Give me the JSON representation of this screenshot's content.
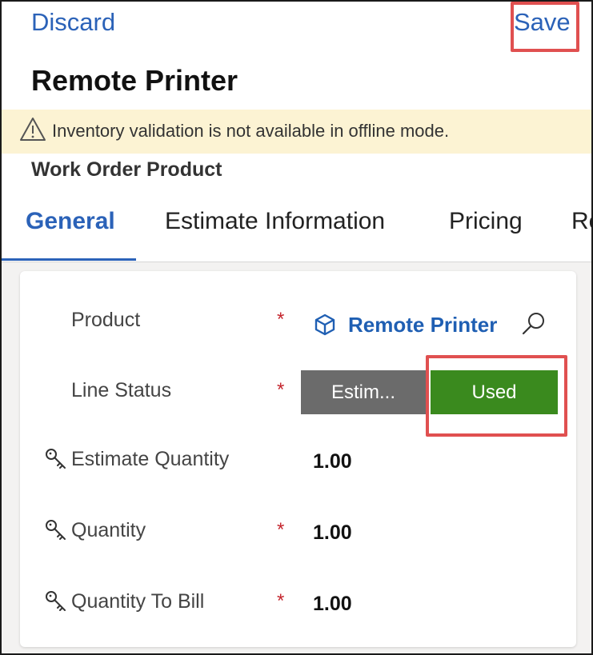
{
  "header": {
    "discard_label": "Discard",
    "save_label": "Save",
    "record_title": "Remote Printer"
  },
  "banner": {
    "icon": "warning-triangle-icon",
    "message": "Inventory validation is not available in offline mode."
  },
  "form": {
    "entity_name": "Work Order Product",
    "tabs": [
      {
        "label": "General",
        "active": true
      },
      {
        "label": "Estimate Information",
        "active": false
      },
      {
        "label": "Pricing",
        "active": false
      },
      {
        "label": "Re",
        "active": false
      }
    ]
  },
  "fields": {
    "product": {
      "label": "Product",
      "required": "*",
      "value": "Remote Printer",
      "icon": "cube-icon",
      "lookup_icon": "search-icon"
    },
    "line_status": {
      "label": "Line Status",
      "required": "*",
      "options": [
        "Estim...",
        "Used"
      ],
      "selected": "Used"
    },
    "estimate_quantity": {
      "label": "Estimate Quantity",
      "value": "1.00",
      "locked_icon": "key-icon"
    },
    "quantity": {
      "label": "Quantity",
      "required": "*",
      "value": "1.00",
      "locked_icon": "key-icon"
    },
    "quantity_to_bill": {
      "label": "Quantity To Bill",
      "required": "*",
      "value": "1.00",
      "locked_icon": "key-icon"
    }
  },
  "colors": {
    "accent_blue": "#2b62b8",
    "used_green": "#3a8a1e",
    "estim_gray": "#6b6b6b",
    "warning_bg": "#fcf3d3",
    "required_red": "#c4262e",
    "highlight_red": "#e05050"
  }
}
